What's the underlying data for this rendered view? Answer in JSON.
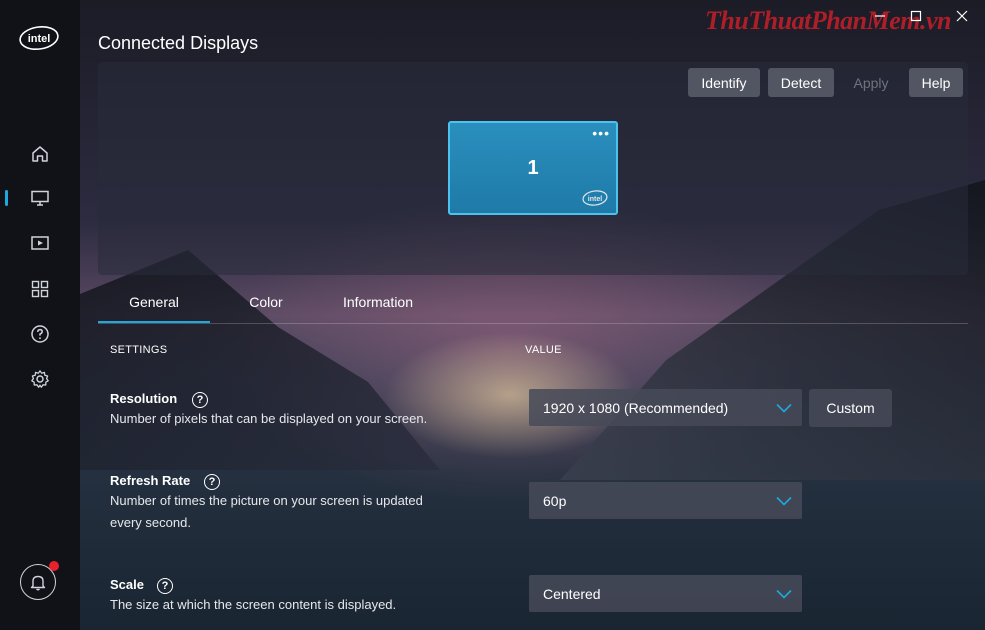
{
  "app": {
    "page_title": "Connected Displays",
    "watermark": "ThuThuatPhanMem.vn",
    "logo_text": "intel"
  },
  "sidebar": {
    "items": [
      {
        "name": "home",
        "icon": "home-icon",
        "active": false
      },
      {
        "name": "display",
        "icon": "monitor-icon",
        "active": true
      },
      {
        "name": "video",
        "icon": "video-icon",
        "active": false
      },
      {
        "name": "apps",
        "icon": "grid-icon",
        "active": false
      },
      {
        "name": "help",
        "icon": "help-circle-icon",
        "active": false
      },
      {
        "name": "settings",
        "icon": "gear-icon",
        "active": false
      }
    ],
    "notification_icon": "bell-icon"
  },
  "display_panel": {
    "buttons": {
      "identify": "Identify",
      "detect": "Detect",
      "apply": "Apply",
      "help": "Help"
    },
    "monitor": {
      "number": "1",
      "menu": "•••",
      "badge": "intel"
    }
  },
  "tabs": [
    {
      "label": "General",
      "active": true
    },
    {
      "label": "Color",
      "active": false
    },
    {
      "label": "Information",
      "active": false
    }
  ],
  "settings": {
    "col_settings": "SETTINGS",
    "col_value": "VALUE",
    "resolution": {
      "name": "Resolution",
      "desc": "Number of pixels that can be displayed on your screen.",
      "value": "1920 x 1080 (Recommended)",
      "custom_label": "Custom"
    },
    "refresh_rate": {
      "name": "Refresh Rate",
      "desc_line1": "Number of times the picture on your screen is updated",
      "desc_line2": "every second.",
      "value": "60p"
    },
    "scale": {
      "name": "Scale",
      "desc": "The size at which the screen content is displayed.",
      "value": "Centered"
    },
    "help_glyph": "?"
  },
  "colors": {
    "accent": "#1ea8dd",
    "monitor_fill": "#2a8fbd",
    "notification_dot": "#e8222b"
  }
}
